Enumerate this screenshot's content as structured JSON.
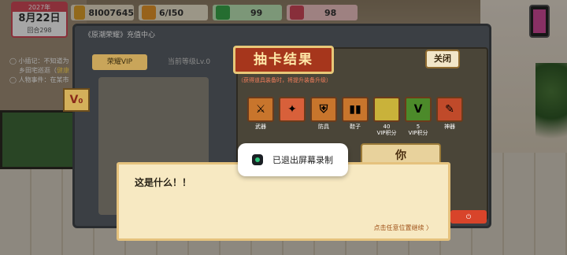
{
  "hud": {
    "year": "2027年",
    "date": "8月22日",
    "turn": "回合298",
    "cash_label": "现金",
    "cash": "8I007645",
    "energy_label": "体力",
    "energy": "6/I50",
    "health_label": "健康",
    "health": "99",
    "mood_label": "心情",
    "mood": "98"
  },
  "news": {
    "line1_prefix": "◯ 小插记：不知道为",
    "line1b_prefix": "乡田宅巡逛（",
    "line1b_hl": "健康",
    "line2": "◯ 人物事件：在某市"
  },
  "panel": {
    "title": "《原潮荣耀》充值中心",
    "vip_tab": "荣耀VIP",
    "level_tab": "当前等级Lv.0",
    "vip_badge": "V₀"
  },
  "result": {
    "title": "抽卡结果",
    "close": "关闭",
    "hint": "（获得道具装备时，将提升装备升级）",
    "items": [
      {
        "label": "武器",
        "glyph": "⚔",
        "color": "#c8752c"
      },
      {
        "label": "",
        "glyph": "✦",
        "color": "#d8603a"
      },
      {
        "label": "防具",
        "glyph": "⛨",
        "color": "#c8752c"
      },
      {
        "label": "鞋子",
        "glyph": "▮▮",
        "color": "#c8752c"
      },
      {
        "label": "40\nVIP积分",
        "glyph": "",
        "color": "#c9b23a"
      },
      {
        "label": "5\nVIP积分",
        "glyph": "V",
        "color": "#4c8a2a"
      },
      {
        "label": "神器",
        "glyph": "✎",
        "color": "#c04a2a"
      }
    ]
  },
  "toast": {
    "text": "已退出屏幕录制"
  },
  "choice": {
    "you": "你"
  },
  "dialog": {
    "text": "这是什么！！",
    "continue": "点击任意位置继续 〉"
  }
}
